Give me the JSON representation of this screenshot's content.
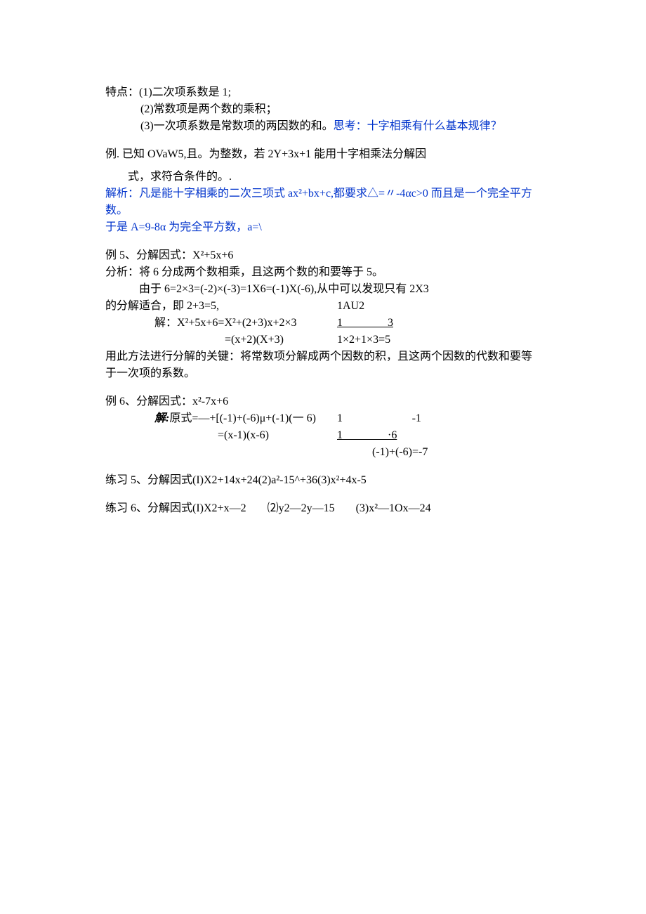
{
  "features": {
    "header": "特点：(1)二次项系数是 1;",
    "line2": "(2)常数项是两个数的乘积；",
    "line3a": "(3)一次项系数是常数项的两因数的和。",
    "line3b": "思考：十字相乘有什么基本规律？"
  },
  "example_known": {
    "line1": "例. 已知 OVaW5,且。为整数，若 2Y+3x+1 能用十字相乘法分解因",
    "line2": "式，求符合条件的。.",
    "analysis1": "解析：凡是能十字相乘的二次三项式 ax²+bx+c,都要求△=〃-4αc>0 而且是一个完全平方数。",
    "analysis2": "于是 A=9-8α 为完全平方数，a=\\"
  },
  "example5": {
    "title": "例 5、分解因式：X²+5x+6",
    "analysis1": "分析：将 6 分成两个数相乘，且这两个数的和要等于 5。",
    "analysis2": "由于 6=2×3=(-2)×(-3)=1X6=(-1)X(-6),从中可以发现只有 2X3",
    "analysis3": "的分解适合，即 2+3=5,",
    "cross_r1": "1AU2",
    "solve_label": "解：",
    "eq1_left": "X²+5x+6=X²+(2+3)x+2×3",
    "eq1_right": "1________3",
    "eq2_left": "=(x+2)(X+3)",
    "eq2_right": "1×2+1×3=5",
    "conclusion": "用此方法进行分解的关键：将常数项分解成两个因数的积，且这两个因数的代数和要等于一次项的系数。"
  },
  "example6": {
    "title": "例 6、分解因式：x²-7x+6",
    "solve_label": "解:",
    "eq1_left": "原式=—+[(-1)+(-6)μ+(-1)(一 6)",
    "eq1_right_a": "1",
    "eq1_right_b": "-1",
    "eq2_left": "=(x-1)(x-6)",
    "eq2_right": "1________·6",
    "eq3_right": "(-1)+(-6)=-7"
  },
  "practice5": {
    "text": "练习 5、分解因式(I)X2+14x+24(2)a²-15^+36(3)x²+4x-5"
  },
  "practice6": {
    "t1": "练习 6、分解因式(I)X2+x—2",
    "t2": "⑵y2—2y—15",
    "t3": "(3)x²—1Ox—24"
  }
}
